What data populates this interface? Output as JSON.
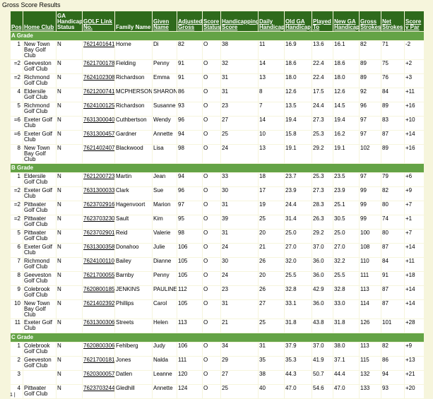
{
  "page": {
    "title": "Gross Score Results",
    "pager": "1 |"
  },
  "columns": [
    {
      "key": "pos",
      "label": "Pos",
      "link": true
    },
    {
      "key": "club",
      "label": "Home Club",
      "link": true
    },
    {
      "key": "ga",
      "label": "GA Handicap Status",
      "link": false
    },
    {
      "key": "golf",
      "label": "GOLF Link No.",
      "link": true
    },
    {
      "key": "family",
      "label": "Family Name",
      "link": false
    },
    {
      "key": "given",
      "label": "Given Name",
      "link": true
    },
    {
      "key": "adj",
      "label": "Adjusted Gross",
      "link": true
    },
    {
      "key": "status",
      "label": "Score Status",
      "link": true
    },
    {
      "key": "hcpscore",
      "label": "Handicapping Score",
      "link": true
    },
    {
      "key": "daily",
      "label": "Daily Handicap",
      "link": true
    },
    {
      "key": "oldga",
      "label": "Old GA Handicap",
      "link": true
    },
    {
      "key": "played",
      "label": "Played To",
      "link": true
    },
    {
      "key": "newga",
      "label": "New GA Handicap",
      "link": true
    },
    {
      "key": "gross",
      "label": "Gross Strokes",
      "link": true
    },
    {
      "key": "net",
      "label": "Net Strokes",
      "link": true
    },
    {
      "key": "vpar",
      "label": "Score v Par",
      "link": true
    }
  ],
  "grades": [
    {
      "name": "A Grade",
      "rows": [
        [
          "1",
          "New Town Bay Golf Club",
          "N",
          "7621401641",
          "Horne",
          "Di",
          "82",
          "O",
          "38",
          "11",
          "16.9",
          "13.6",
          "16.1",
          "82",
          "71",
          "-2"
        ],
        [
          "=2",
          "Geeveston Golf Club",
          "N",
          "7621700178",
          "Fielding",
          "Penny",
          "91",
          "O",
          "32",
          "14",
          "18.6",
          "22.4",
          "18.6",
          "89",
          "75",
          "+2"
        ],
        [
          "=2",
          "Richmond Golf Club",
          "N",
          "7624102308",
          "Richardson",
          "Emma",
          "91",
          "O",
          "31",
          "13",
          "18.0",
          "22.4",
          "18.0",
          "89",
          "76",
          "+3"
        ],
        [
          "4",
          "Eldersile Golf Club",
          "N",
          "7621200741",
          "MCPHERSON",
          "SHARON",
          "86",
          "O",
          "31",
          "8",
          "12.6",
          "17.5",
          "12.6",
          "92",
          "84",
          "+11"
        ],
        [
          "5",
          "Richmond Golf Club",
          "N",
          "7624100125",
          "Richardson",
          "Susanne",
          "93",
          "O",
          "23",
          "7",
          "13.5",
          "24.4",
          "14.5",
          "96",
          "89",
          "+16"
        ],
        [
          "=6",
          "Exeter Golf Club",
          "N",
          "7631300040",
          "Cuthbertson",
          "Wendy",
          "96",
          "O",
          "27",
          "14",
          "19.4",
          "27.3",
          "19.4",
          "97",
          "83",
          "+10"
        ],
        [
          "=6",
          "Exeter Golf Club",
          "N",
          "7631300457",
          "Gardner",
          "Annette",
          "94",
          "O",
          "25",
          "10",
          "15.8",
          "25.3",
          "16.2",
          "97",
          "87",
          "+14"
        ],
        [
          "8",
          "New Town Bay Golf Club",
          "N",
          "7621402407",
          "Blackwood",
          "Lisa",
          "98",
          "O",
          "24",
          "13",
          "19.1",
          "29.2",
          "19.1",
          "102",
          "89",
          "+16"
        ]
      ]
    },
    {
      "name": "B Grade",
      "rows": [
        [
          "1",
          "Eldersile Golf Club",
          "N",
          "7621200723",
          "Martin",
          "Jean",
          "94",
          "O",
          "33",
          "18",
          "23.7",
          "25.3",
          "23.5",
          "97",
          "79",
          "+6"
        ],
        [
          "=2",
          "Exeter Golf Club",
          "N",
          "7631300033",
          "Clark",
          "Sue",
          "96",
          "O",
          "30",
          "17",
          "23.9",
          "27.3",
          "23.9",
          "99",
          "82",
          "+9"
        ],
        [
          "=2",
          "Pittwater Golf Club",
          "N",
          "7623702916",
          "Hagenvoort",
          "Marion",
          "97",
          "O",
          "31",
          "19",
          "24.4",
          "28.3",
          "25.1",
          "99",
          "80",
          "+7"
        ],
        [
          "=2",
          "Pittwater Golf Club",
          "N",
          "7623703230",
          "Sault",
          "Kim",
          "95",
          "O",
          "39",
          "25",
          "31.4",
          "26.3",
          "30.5",
          "99",
          "74",
          "+1"
        ],
        [
          "5",
          "Pittwater Golf Club",
          "N",
          "7623702901",
          "Reid",
          "Valerie",
          "98",
          "O",
          "31",
          "20",
          "25.0",
          "29.2",
          "25.0",
          "100",
          "80",
          "+7"
        ],
        [
          "6",
          "Exeter Golf Club",
          "N",
          "7631300358",
          "Donahoo",
          "Julie",
          "106",
          "O",
          "24",
          "21",
          "27.0",
          "37.0",
          "27.0",
          "108",
          "87",
          "+14"
        ],
        [
          "7",
          "Richmond Golf Club",
          "N",
          "7624100110",
          "Bailey",
          "Dianne",
          "105",
          "O",
          "30",
          "26",
          "32.0",
          "36.0",
          "32.2",
          "110",
          "84",
          "+11"
        ],
        [
          "8",
          "Geeveston Golf Club",
          "N",
          "7621700055",
          "Barnby",
          "Penny",
          "105",
          "O",
          "24",
          "20",
          "25.5",
          "36.0",
          "25.5",
          "111",
          "91",
          "+18"
        ],
        [
          "9",
          "Colebrook Golf Club",
          "N",
          "7620800185",
          "JENKINS",
          "PAULINE",
          "112",
          "O",
          "23",
          "26",
          "32.8",
          "42.9",
          "32.8",
          "113",
          "87",
          "+14"
        ],
        [
          "10",
          "New Town Bay Golf Club",
          "N",
          "7621402392",
          "Phillips",
          "Carol",
          "105",
          "O",
          "31",
          "27",
          "33.1",
          "36.0",
          "33.0",
          "114",
          "87",
          "+14"
        ],
        [
          "11",
          "Exeter Golf Club",
          "N",
          "7631300306",
          "Streets",
          "Helen",
          "113",
          "O",
          "21",
          "25",
          "31.8",
          "43.8",
          "31.8",
          "126",
          "101",
          "+28"
        ]
      ]
    },
    {
      "name": "C Grade",
      "rows": [
        [
          "1",
          "Colebrook Golf Club",
          "N",
          "7620800306",
          "Fehlberg",
          "Judy",
          "106",
          "O",
          "34",
          "31",
          "37.9",
          "37.0",
          "38.0",
          "113",
          "82",
          "+9"
        ],
        [
          "2",
          "Geeveston Golf Club",
          "N",
          "7621700181",
          "Jones",
          "Nalda",
          "111",
          "O",
          "29",
          "35",
          "35.3",
          "41.9",
          "37.1",
          "115",
          "86",
          "+13"
        ],
        [
          "3",
          "",
          "N",
          "7620300057",
          "Datlen",
          "Leanne",
          "120",
          "O",
          "27",
          "38",
          "44.3",
          "50.7",
          "44.4",
          "132",
          "94",
          "+21"
        ],
        [
          "4",
          "Pittwater Golf Club",
          "N",
          "7623703244",
          "Gledhill",
          "Annette",
          "124",
          "O",
          "25",
          "40",
          "47.0",
          "54.6",
          "47.0",
          "133",
          "93",
          "+20"
        ]
      ]
    }
  ]
}
